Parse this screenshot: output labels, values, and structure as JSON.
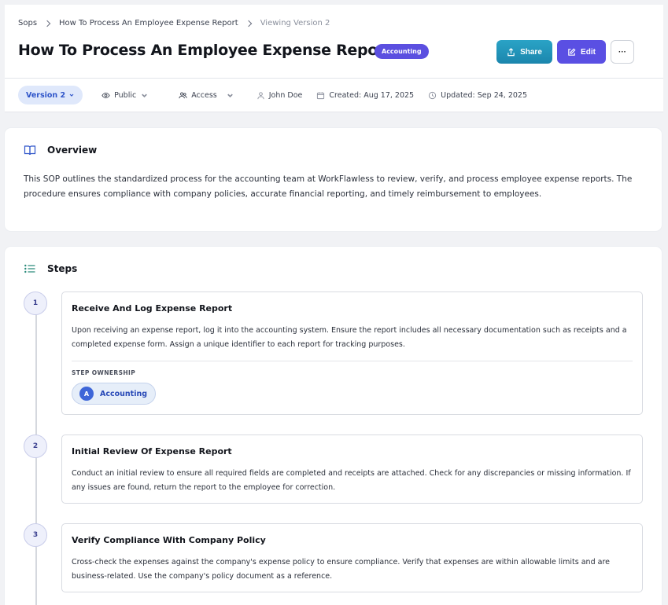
{
  "breadcrumb": {
    "root": "Sops",
    "parent": "How To Process An Employee Expense Report",
    "current": "Viewing Version 2"
  },
  "title": "How To Process An Employee Expense Report",
  "badge": "Accounting",
  "actions": {
    "share": "Share",
    "edit": "Edit",
    "more": "···"
  },
  "meta": {
    "version": "Version 2",
    "visibility": "Public",
    "access": "Access",
    "author": "John Doe",
    "created": "Created: Aug 17, 2025",
    "updated": "Updated: Sep 24, 2025"
  },
  "overview": {
    "heading": "Overview",
    "text": "This SOP outlines the standardized process for the accounting team at WorkFlawless to review, verify, and process employee expense reports. The procedure ensures compliance with company policies, accurate financial reporting, and timely reimbursement to employees."
  },
  "steps": {
    "heading": "Steps",
    "items": [
      {
        "number": "1",
        "title": "Receive And Log Expense Report",
        "description": "Upon receiving an expense report, log it into the accounting system. Ensure the report includes all necessary documentation such as receipts and a completed expense form. Assign a unique identifier to each report for tracking purposes.",
        "ownership_label": "STEP OWNERSHIP",
        "owner": "Accounting",
        "owner_initial": "A"
      },
      {
        "number": "2",
        "title": "Initial Review Of Expense Report",
        "description": "Conduct an initial review to ensure all required fields are completed and receipts are attached. Check for any discrepancies or missing information. If any issues are found, return the report to the employee for correction."
      },
      {
        "number": "3",
        "title": "Verify Compliance With Company Policy",
        "description": "Cross-check the expenses against the company's expense policy to ensure compliance. Verify that expenses are within allowable limits and are business-related. Use the company's policy document as a reference."
      }
    ]
  },
  "colors": {
    "accent": "#5a4fe3",
    "share": "#1b86ad",
    "version_pill": "#dfe8fb"
  }
}
